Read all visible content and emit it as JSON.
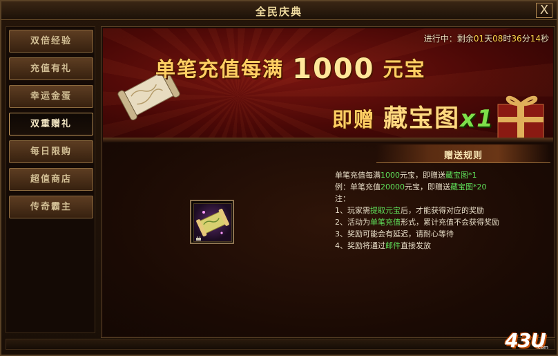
{
  "window": {
    "title": "全民庆典",
    "close_label": "X"
  },
  "sidebar": {
    "items": [
      {
        "label": "双倍经验",
        "active": false
      },
      {
        "label": "充值有礼",
        "active": false
      },
      {
        "label": "幸运金蛋",
        "active": false
      },
      {
        "label": "双重赠礼",
        "active": true
      },
      {
        "label": "每日限购",
        "active": false
      },
      {
        "label": "超值商店",
        "active": false
      },
      {
        "label": "传奇霸主",
        "active": false
      }
    ]
  },
  "banner": {
    "timer": {
      "prefix": "进行中：剩余",
      "days": "01",
      "days_unit": "天",
      "hours": "08",
      "hours_unit": "时",
      "minutes": "36",
      "minutes_unit": "分",
      "seconds": "14",
      "seconds_unit": "秒"
    },
    "line1_prefix": "单笔充值每满",
    "line1_amount": "1000",
    "line1_suffix": "元宝",
    "line2_prefix": "即赠",
    "line2_item": "藏宝图",
    "line2_multiplier": "x1"
  },
  "rules": {
    "header": "赠送规则",
    "lines": [
      {
        "a": "单笔充值每满",
        "b": "1000",
        "c": "元宝，即赠送",
        "d": "藏宝图*1",
        "e": ""
      },
      {
        "a": "例：单笔充值",
        "b": "20000",
        "c": "元宝，即赠送",
        "d": "藏宝图*20",
        "e": ""
      },
      {
        "a": "注：",
        "b": "",
        "c": "",
        "d": "",
        "e": ""
      },
      {
        "a": "1、玩家需",
        "b": "",
        "c": "",
        "d": "提取元宝",
        "e": "后，才能获得对应的奖励"
      },
      {
        "a": "2、活动为",
        "b": "",
        "c": "",
        "d": "单笔充值",
        "e": "形式，累计充值不会获得奖励"
      },
      {
        "a": "3、奖励可能会有延迟，请耐心等待",
        "b": "",
        "c": "",
        "d": "",
        "e": ""
      },
      {
        "a": "4、奖励将通过",
        "b": "",
        "c": "",
        "d": "邮件",
        "e": "直接发放"
      }
    ]
  },
  "reward_item": {
    "icon": "treasure-map-icon"
  },
  "watermark": {
    "text": "43U",
    "sub": ".com"
  },
  "colors": {
    "highlight": "#5fe05a",
    "gold": "#ffcf63",
    "timer_num": "#ffd54a"
  }
}
